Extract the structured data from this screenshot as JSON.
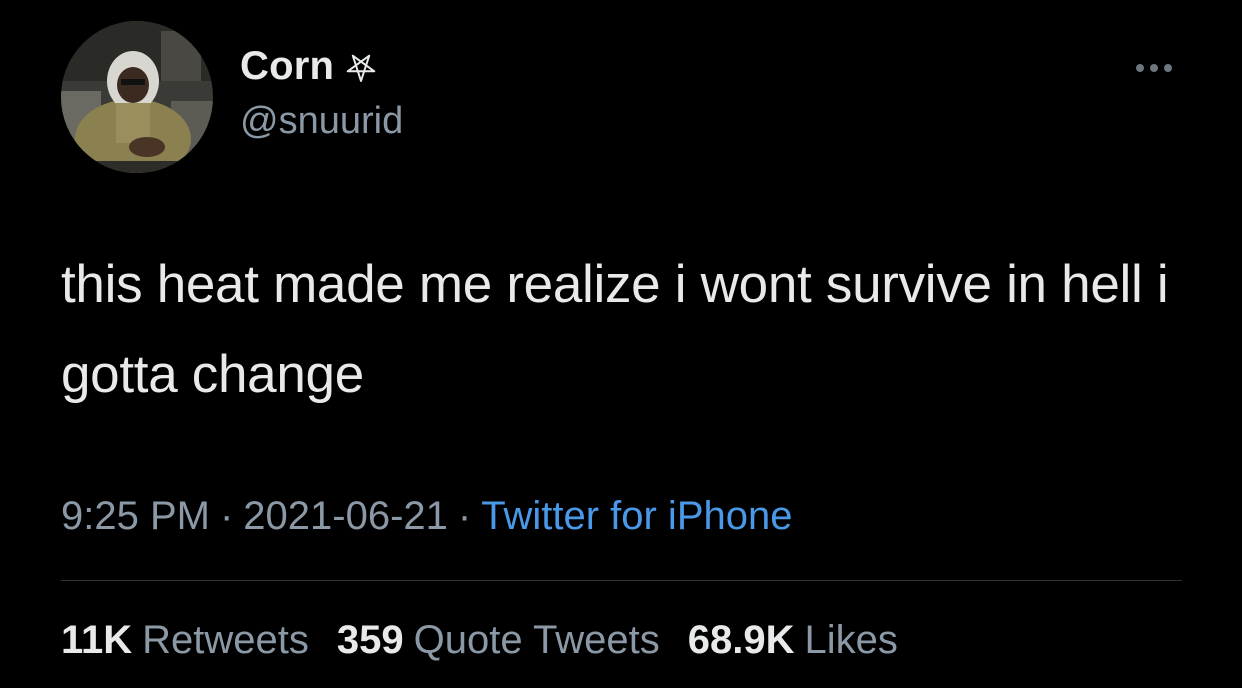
{
  "author": {
    "display_name": "Corn",
    "name_emoji": "pentagram-icon",
    "handle": "@snuurid"
  },
  "tweet": {
    "text": "this heat made me realize i wont survive in hell i gotta change"
  },
  "meta": {
    "time": "9:25 PM",
    "separator": "·",
    "date": "2021-06-21",
    "source": "Twitter for iPhone"
  },
  "stats": {
    "retweets_count": "11K",
    "retweets_label": "Retweets",
    "quotes_count": "359",
    "quotes_label": "Quote Tweets",
    "likes_count": "68.9K",
    "likes_label": "Likes"
  },
  "colors": {
    "background": "#000000",
    "primary_text": "#e7e9ea",
    "secondary_text": "#8b98a5",
    "link": "#4a99e9",
    "divider": "#2f3336"
  }
}
